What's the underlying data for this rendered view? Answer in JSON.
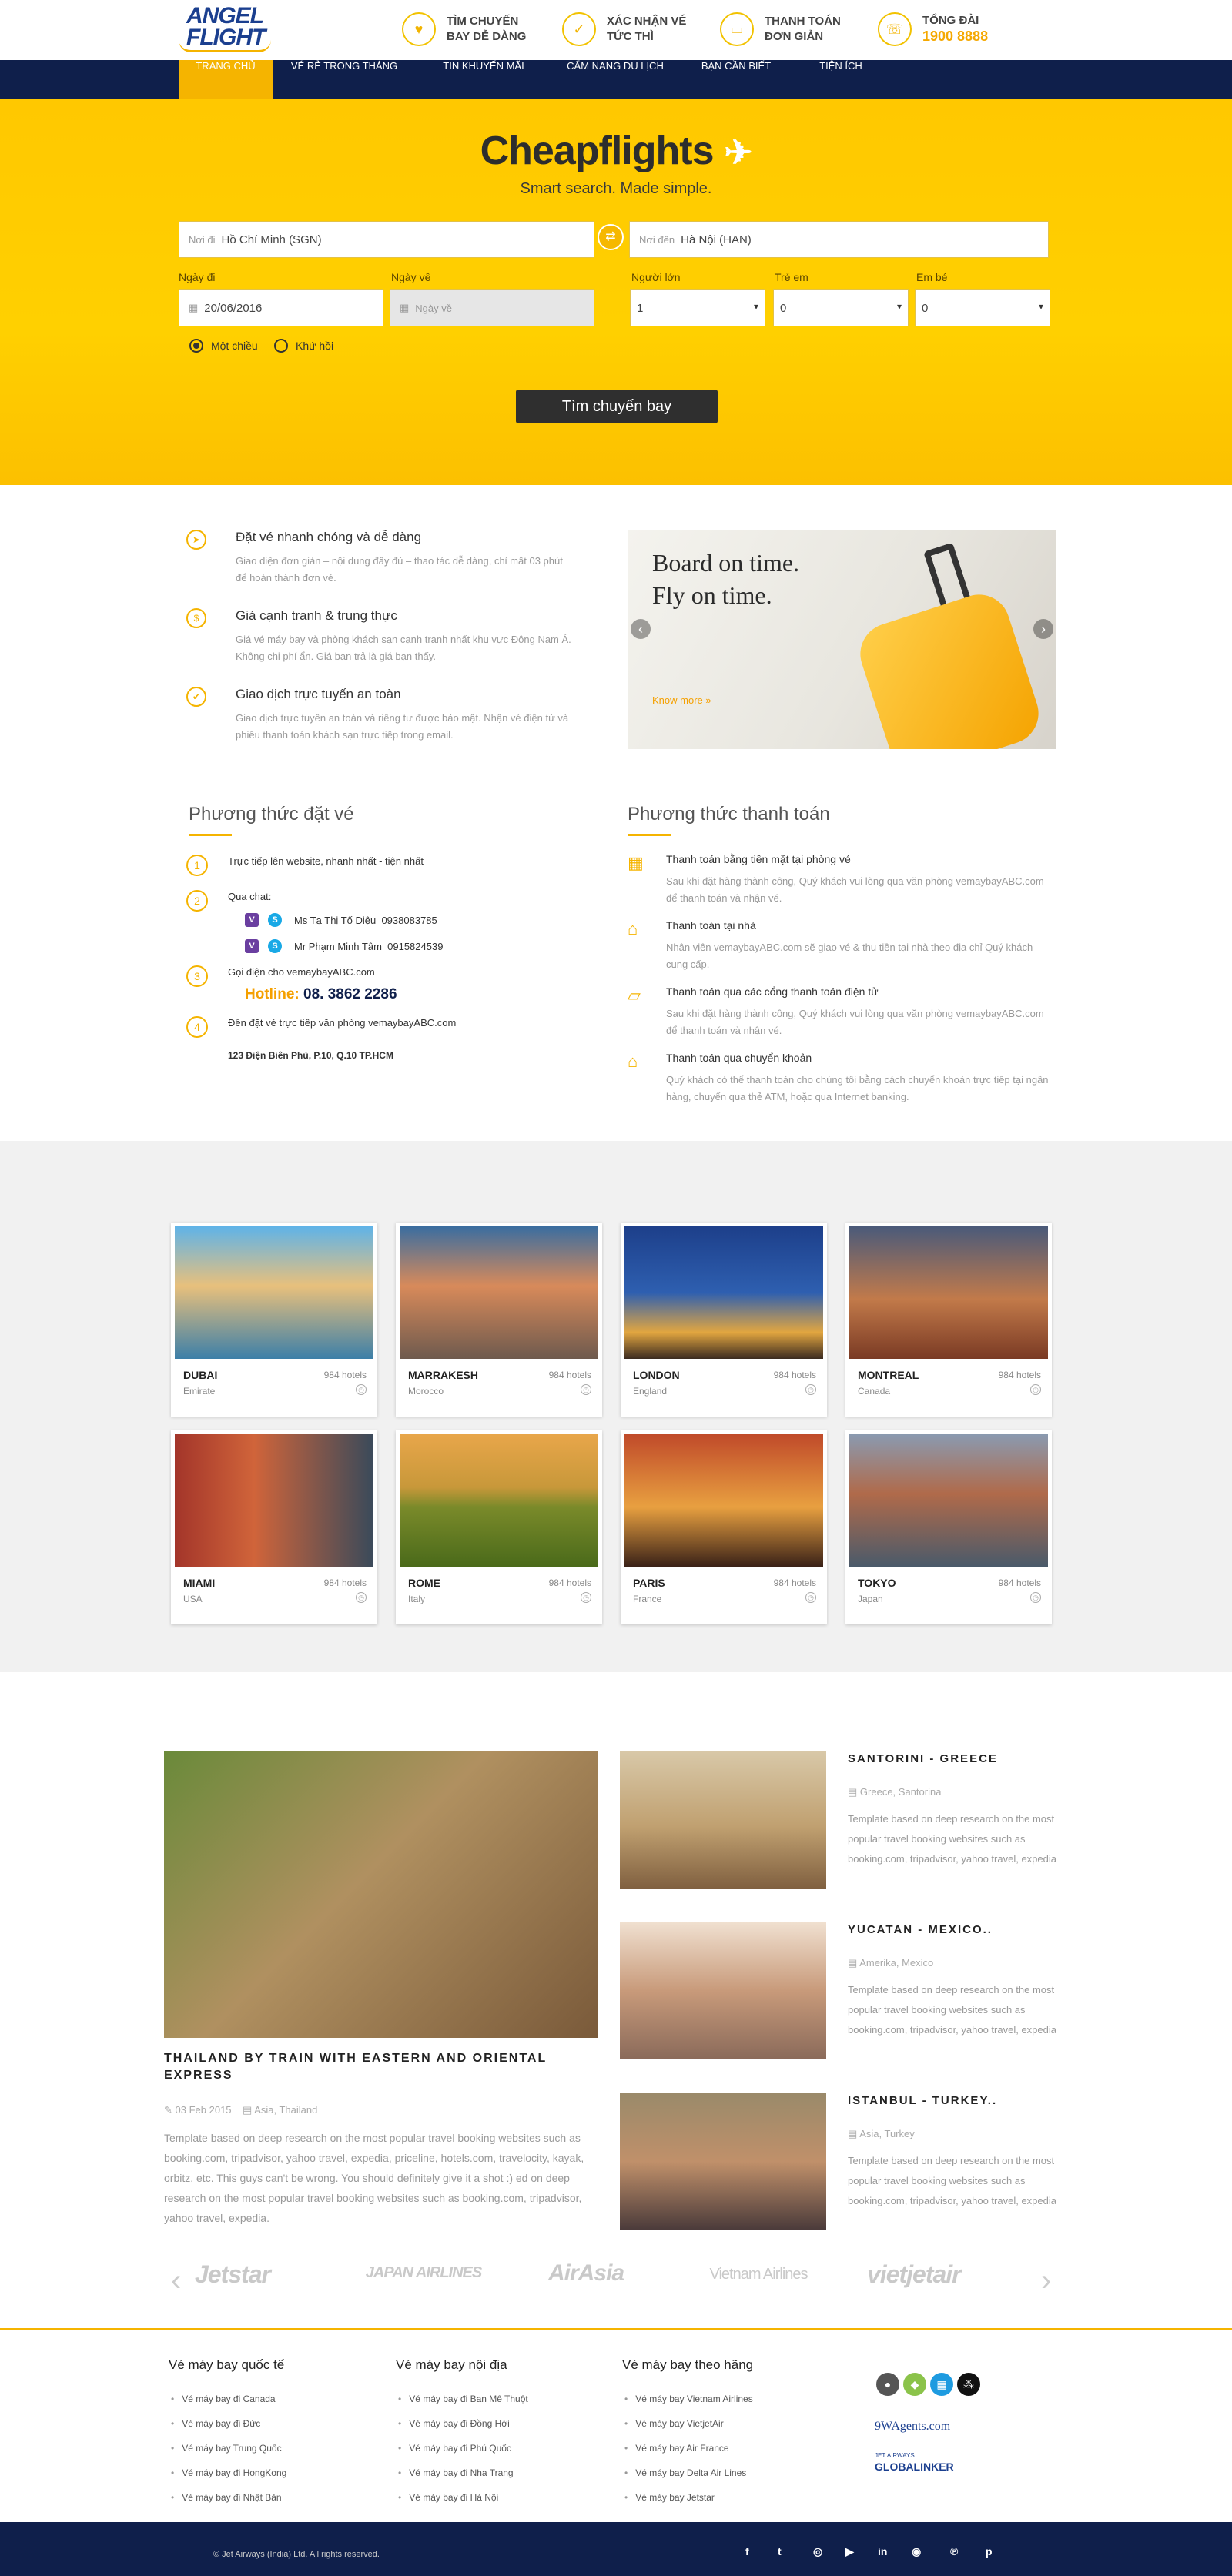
{
  "header": {
    "logo_line1": "ANGEL",
    "logo_line2": "FLIGHT",
    "features": [
      {
        "icon": "heart-icon",
        "line1": "Tìm chuyến",
        "line2": "bay dễ dàng"
      },
      {
        "icon": "check-icon",
        "line1": "Xác nhận vé",
        "line2": "tức thì"
      },
      {
        "icon": "card-icon",
        "line1": "Thanh toán",
        "line2": "đơn giản"
      },
      {
        "icon": "phone-icon",
        "line1": "Tổng đài",
        "line2": "1900 8888"
      }
    ]
  },
  "nav": {
    "items": [
      "Trang chủ",
      "Vé rẻ trong tháng",
      "Tin khuyến mãi",
      "Cẩm nang du lịch",
      "Bạn cần biết",
      "Tiện ích"
    ]
  },
  "search": {
    "brand": "Cheapflights",
    "tagline": "Smart search. Made simple.",
    "from_placeholder": "Nơi đi",
    "from_value": "Hồ Chí Minh (SGN)",
    "to_placeholder": "Nơi đến",
    "to_value": "Hà Nội (HAN)",
    "depart_label": "Ngày đi",
    "depart_value": "20/06/2016",
    "return_label": "Ngày về",
    "return_placeholder": "Ngày về",
    "adult_label": "Người lớn",
    "adult_value": "1",
    "child_label": "Trẻ em",
    "child_value": "0",
    "infant_label": "Em bé",
    "infant_value": "0",
    "oneway_label": "Một chiều",
    "roundtrip_label": "Khứ hồi",
    "button": "Tìm chuyến bay"
  },
  "features": [
    {
      "title": "Đặt vé nhanh chóng và dễ dàng",
      "desc": "Giao diện đơn giản – nội dung đầy đủ – thao tác dễ dàng, chỉ mất 03 phút để hoàn thành đơn vé."
    },
    {
      "title": "Giá cạnh tranh & trung thực",
      "desc": "Giá vé máy bay và phòng khách sạn cạnh tranh nhất khu vực Đông Nam Á. Không chi phí ẩn. Giá bạn trả là giá bạn thấy."
    },
    {
      "title": "Giao dịch trực tuyến an toàn",
      "desc": "Giao dịch trực tuyến an toàn và riêng tư được bảo mật. Nhận vé điện tử và phiếu thanh toán khách sạn trực tiếp trong email."
    }
  ],
  "banner": {
    "line1": "Board on time.",
    "line2": "Fly on time.",
    "link": "Know more »"
  },
  "booking": {
    "title": "Phương thức đặt vé",
    "steps": [
      {
        "n": "1",
        "text": "Trực tiếp lên website, nhanh nhất - tiện nhất"
      },
      {
        "n": "2",
        "text": "Qua chat:"
      },
      {
        "n": "3",
        "text": "Gọi điện cho vemaybayABC.com"
      },
      {
        "n": "4",
        "text": "Đến đặt vé trực tiếp văn phòng vemaybayABC.com"
      }
    ],
    "chat": [
      {
        "name": "Ms Tạ Thị Tố Diệu",
        "phone": "0938083785"
      },
      {
        "name": "Mr Phạm Minh Tâm",
        "phone": "0915824539"
      }
    ],
    "hotline_label": "Hotline:",
    "hotline": "08. 3862 2286",
    "address": "123 Điện Biên Phủ, P.10, Q.10 TP.HCM"
  },
  "payment": {
    "title": "Phương thức thanh toán",
    "items": [
      {
        "title": "Thanh toán bằng tiền mặt tại phòng vé",
        "desc": "Sau khi đặt hàng thành công, Quý khách vui lòng qua văn phòng vemaybayABC.com để thanh toán và nhận vé."
      },
      {
        "title": "Thanh toán tại nhà",
        "desc": "Nhân viên vemaybayABC.com sẽ giao vé & thu tiền tại nhà theo địa chỉ Quý khách cung cấp."
      },
      {
        "title": "Thanh toán qua các cổng thanh toán điện tử",
        "desc": "Sau khi đặt hàng thành công, Quý khách vui lòng qua văn phòng vemaybayABC.com để thanh toán và nhận vé."
      },
      {
        "title": "Thanh toán qua chuyển khoản",
        "desc": "Quý khách có thể thanh toán cho chúng tôi bằng cách chuyển khoản trực tiếp tại ngân hàng, chuyển qua thẻ ATM, hoặc qua Internet banking."
      }
    ]
  },
  "destinations": [
    {
      "name": "Dubai",
      "country": "Emirate",
      "hotels": "984 hotels"
    },
    {
      "name": "Marrakesh",
      "country": "Morocco",
      "hotels": "984 hotels"
    },
    {
      "name": "London",
      "country": "England",
      "hotels": "984 hotels"
    },
    {
      "name": "Montreal",
      "country": "Canada",
      "hotels": "984 hotels"
    },
    {
      "name": "Miami",
      "country": "USA",
      "hotels": "984 hotels"
    },
    {
      "name": "Rome",
      "country": "Italy",
      "hotels": "984 hotels"
    },
    {
      "name": "Paris",
      "country": "France",
      "hotels": "984 hotels"
    },
    {
      "name": "Tokyo",
      "country": "Japan",
      "hotels": "984 hotels"
    }
  ],
  "blog": {
    "main": {
      "title": "Thailand by train with Eastern and Oriental Express",
      "date": "03 Feb 2015",
      "location": "Asia, Thailand",
      "text": "Template based on deep research on the most popular travel booking websites such as booking.com, tripadvisor, yahoo travel, expedia, priceline, hotels.com, travelocity, kayak, orbitz, etc. This guys can't be wrong. You should definitely give it a shot :) ed on deep research on the most popular travel booking websites such as booking.com, tripadvisor, yahoo travel, expedia."
    },
    "side": [
      {
        "title": "Santorini - Greece",
        "location": "Greece, Santorina",
        "text": "Template based on deep research on the most popular travel booking websites such as booking.com, tripadvisor, yahoo travel, expedia"
      },
      {
        "title": "Yucatan - Mexico..",
        "location": "Amerika, Mexico",
        "text": "Template based on deep research on the most popular travel booking websites such as booking.com, tripadvisor, yahoo travel, expedia"
      },
      {
        "title": "Istanbul - Turkey..",
        "location": "Asia, Turkey",
        "text": "Template based on deep research on the most popular travel booking websites such as booking.com, tripadvisor, yahoo travel, expedia"
      }
    ]
  },
  "airlines": [
    "Jetstar",
    "JAPAN AIRLINES",
    "AirAsia",
    "Vietnam Airlines",
    "vietjetair"
  ],
  "footer": {
    "columns": [
      {
        "title": "Vé máy bay quốc tế",
        "links": [
          "Vé máy bay đi Canada",
          "Vé máy bay đi Đức",
          "Vé máy bay Trung Quốc",
          "Vé máy bay đi HongKong",
          "Vé máy bay đi Nhật Bản"
        ]
      },
      {
        "title": "Vé máy bay nội địa",
        "links": [
          "Vé máy bay đi Ban Mê Thuột",
          "Vé máy bay đi Đồng Hới",
          "Vé máy bay đi Phú Quốc",
          "Vé máy bay đi Nha Trang",
          "Vé máy bay đi Hà Nội"
        ]
      },
      {
        "title": "Vé máy bay theo hãng",
        "links": [
          "Vé máy bay Vietnam Airlines",
          "Vé máy bay VietjetAir",
          "Vé máy bay Air France",
          "Vé máy bay Delta Air Lines",
          "Vé máy bay Jetstar"
        ]
      }
    ],
    "agents": "9WAgents.com",
    "jet_small": "JET AIRWAYS",
    "globalinker": "GLOBALINKER",
    "copyright": "© Jet Airways (India) Ltd. All rights reserved.",
    "social": [
      "f",
      "t",
      "◎",
      "▶",
      "in",
      "◉",
      "℗",
      "p"
    ]
  },
  "colors": {
    "accent": "#f5b400",
    "navy": "#0f1f4b"
  }
}
